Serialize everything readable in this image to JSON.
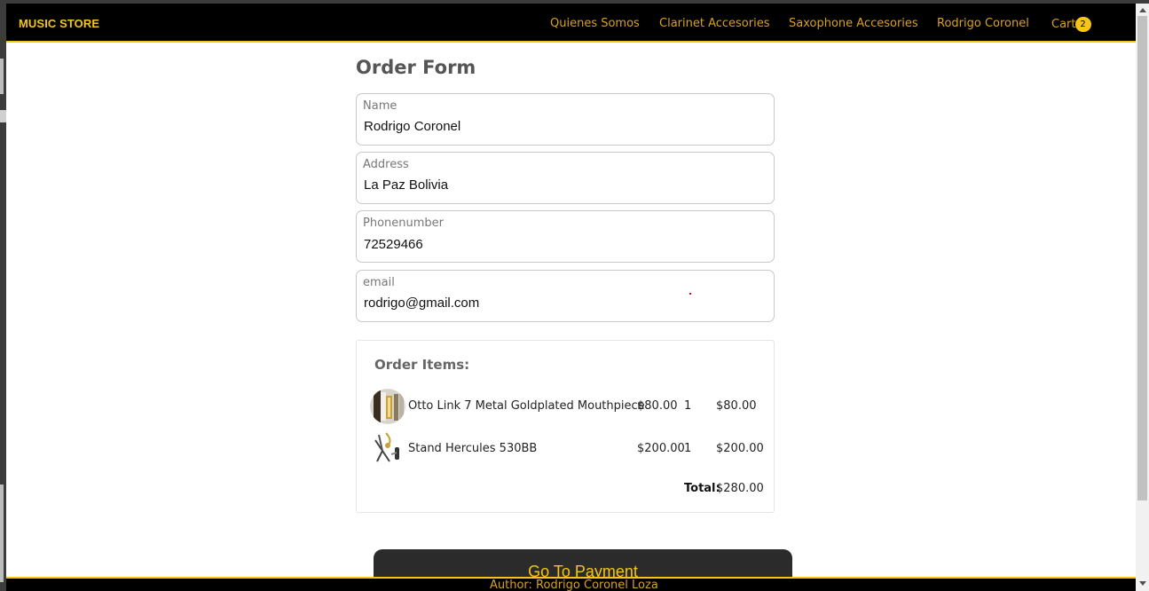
{
  "navbar": {
    "brand": "MUSIC STORE",
    "links": [
      "Quienes Somos",
      "Clarinet Accesories",
      "Saxophone Accesories",
      "Rodrigo Coronel"
    ],
    "cart_label": "Cart",
    "cart_count": "2"
  },
  "form": {
    "title": "Order Form",
    "fields": [
      {
        "label": "Name",
        "value": "Rodrigo Coronel"
      },
      {
        "label": "Address",
        "value": "La Paz Bolivia"
      },
      {
        "label": "Phonenumber",
        "value": "72529466"
      },
      {
        "label": "email",
        "value": "rodrigo@gmail.com"
      }
    ]
  },
  "order": {
    "title": "Order Items:",
    "items": [
      {
        "name": "Otto Link 7 Metal Goldplated Mouthpiece",
        "price": "$80.00",
        "qty": "1",
        "subtotal": "$80.00",
        "icon": "mouthpiece-thumbnail"
      },
      {
        "name": "Stand Hercules 530BB",
        "price": "$200.00",
        "qty": "1",
        "subtotal": "$200.00",
        "icon": "stand-thumbnail"
      }
    ],
    "total_label": "Total:",
    "total_value": "$280.00"
  },
  "payment_button": "Go To Payment",
  "footer": "Author: Rodrigo Coronel Loza",
  "colors": {
    "accent": "#f5c518",
    "nav_link": "#d9a21b",
    "navbar_bg": "#000000",
    "button_bg": "#2b2b2b"
  }
}
